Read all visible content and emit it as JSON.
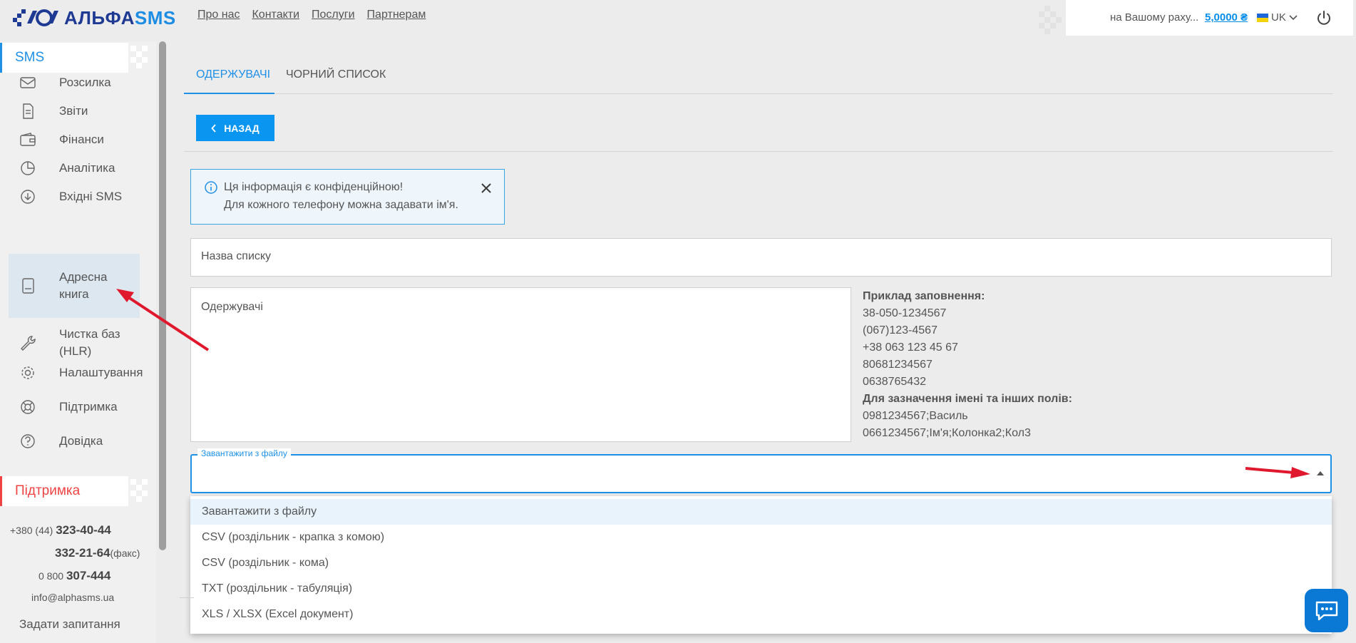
{
  "brand": {
    "logo_a": "АЛЬФА",
    "logo_b": "SMS"
  },
  "topnav": [
    "Про нас",
    "Контакти",
    "Послуги",
    "Партнерам"
  ],
  "account": {
    "label": "на Вашому раху...",
    "balance": "5,0000 ₴",
    "language": "UK"
  },
  "sidebar": {
    "sms_header": "SMS",
    "items": [
      {
        "label": "Розсилка",
        "icon": "envelope-icon"
      },
      {
        "label": "Звіти",
        "icon": "document-icon"
      },
      {
        "label": "Фінанси",
        "icon": "wallet-icon"
      },
      {
        "label": "Аналітика",
        "icon": "pie-chart-icon"
      },
      {
        "label": "Вхідні SMS",
        "icon": "inbox-download-icon"
      },
      {
        "label": "Адресна книга",
        "icon": "address-book-icon",
        "active": true
      },
      {
        "label": "Чистка баз (HLR)",
        "icon": "wrench-icon"
      },
      {
        "label": "Налаштування",
        "icon": "gear-icon"
      },
      {
        "label": "Підтримка",
        "icon": "lifebuoy-icon"
      },
      {
        "label": "Довідка",
        "icon": "help-icon"
      }
    ],
    "support_header": "Підтримка",
    "contacts": {
      "phone1_prefix": "+380 (44)",
      "phone1": "323-40-44",
      "phone2": "332-21-64",
      "phone2_suffix": "(факс)",
      "phone3_prefix": "0 800",
      "phone3": "307-444",
      "email": "info@alphasms.ua"
    },
    "ask": "Задати запитання"
  },
  "tabs": [
    "ОДЕРЖУВАЧІ",
    "ЧОРНИЙ СПИСОК"
  ],
  "back_button": "НАЗАД",
  "info": {
    "line1": "Ця інформація є конфіденційною!",
    "line2": "Для кожного телефону можна задавати ім'я."
  },
  "form": {
    "list_name_placeholder": "Назва списку",
    "recipients_placeholder": "Одержувачі"
  },
  "example": {
    "title": "Приклад заповнення:",
    "lines": [
      "38-050-1234567",
      "(067)123-4567",
      "+38 063 123 45 67",
      "80681234567",
      "0638765432"
    ],
    "title2": "Для зазначення імені та інших полів:",
    "lines2": [
      "0981234567;Василь",
      "0661234567;Ім'я;Колонка2;Кол3"
    ]
  },
  "upload": {
    "label": "Завантажити з файлу",
    "options": [
      "Завантажити з файлу",
      "CSV (роздільник - крапка з комою)",
      "CSV (роздільник - кома)",
      "TXT (роздільник - табуляція)",
      "XLS / XLSX (Excel документ)"
    ],
    "selected_index": 0
  },
  "colors": {
    "accent": "#1e90e6",
    "support": "#ee4444",
    "annotation": "#e0182d"
  }
}
